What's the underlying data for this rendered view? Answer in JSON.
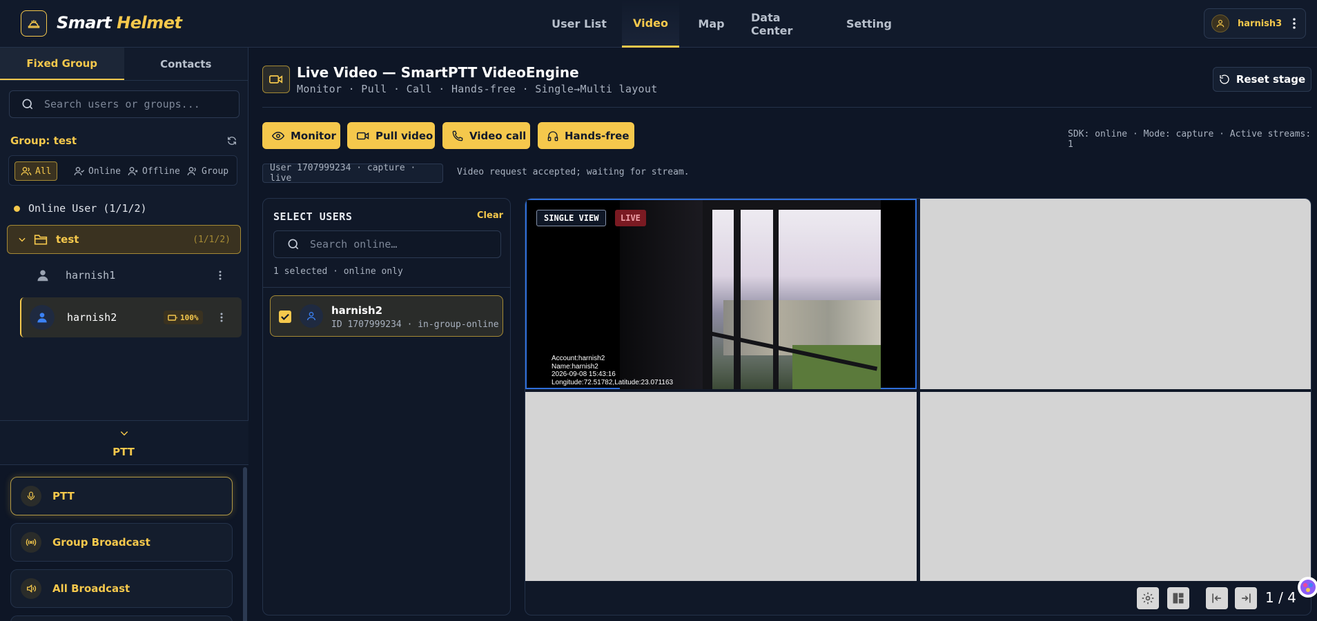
{
  "app": {
    "logo_word1": "Smart",
    "logo_word2": "Helmet",
    "accent": "#f5c84c",
    "logo_icon": "helmet-icon"
  },
  "nav": {
    "items": [
      "User List",
      "Video",
      "Map",
      "Data Center",
      "Setting"
    ],
    "active": "Video"
  },
  "user": {
    "name": "harnish3",
    "icon": "user-icon"
  },
  "sidebar": {
    "tabs": [
      "Fixed Group",
      "Contacts"
    ],
    "search_placeholder": "Search users or groups...",
    "group_title": "Group: test",
    "filters": [
      "All",
      "Online",
      "Offline",
      "Group"
    ],
    "online_summary": "Online User (1/1/2)",
    "folder": {
      "name": "test",
      "count": "(1/1/2)"
    },
    "members": [
      {
        "name": "harnish1",
        "selected": false
      },
      {
        "name": "harnish2",
        "selected": true,
        "battery": "100%"
      }
    ],
    "ptt_label": "PTT",
    "actions": [
      "PTT",
      "Group Broadcast",
      "All Broadcast"
    ]
  },
  "main": {
    "title": "Live Video — SmartPTT VideoEngine",
    "subtitle": "Monitor · Pull · Call · Hands-free · Single→Multi layout",
    "reset_label": "Reset stage",
    "buttons": [
      "Monitor",
      "Pull video",
      "Video call",
      "Hands-free"
    ],
    "sdk_status": "SDK: online · Mode: capture · Active streams: 1",
    "status_chip": "User 1707999234 · capture · live",
    "status_message": "Video request accepted; waiting for stream."
  },
  "selector": {
    "title": "SELECT USERS",
    "clear_label": "Clear",
    "search_placeholder": "Search online…",
    "count_text": "1 selected · online only",
    "card": {
      "name": "harnish2",
      "meta": "ID 1707999234 · in-group-online"
    }
  },
  "video": {
    "badge_view": "SINGLE VIEW",
    "badge_live": "LIVE",
    "osd": [
      "Account:harnish2",
      "Name:harnish2",
      "2026-09-08 15:43:16",
      "Longitude:72.51782,Latitude:23.071163"
    ],
    "pager": "1 / 4"
  }
}
